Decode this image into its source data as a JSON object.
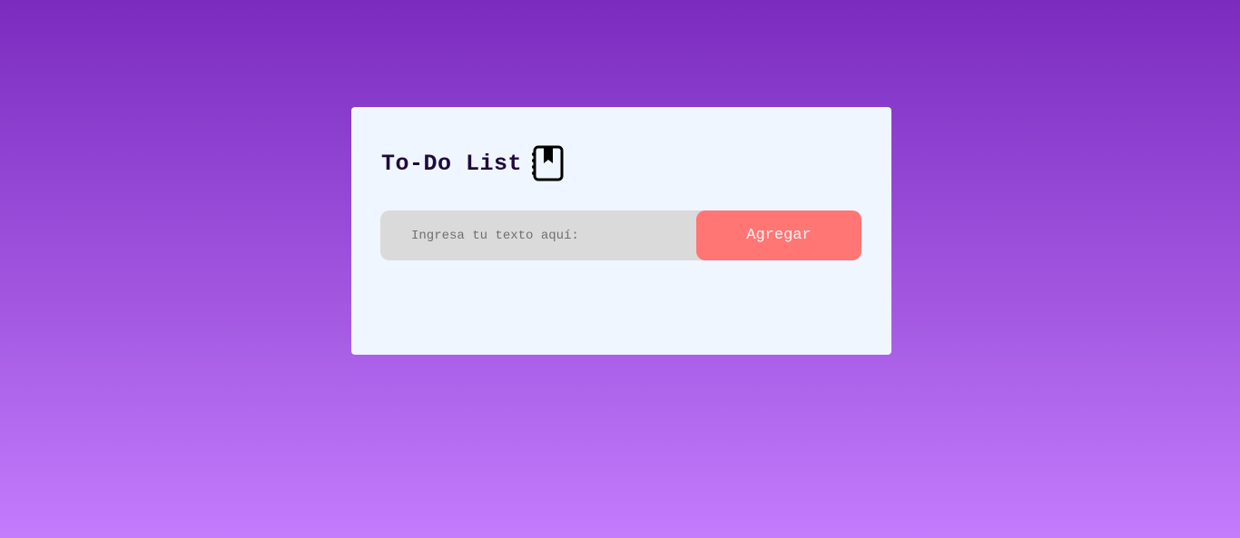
{
  "app": {
    "title": "To-Do List",
    "title_icon": "notebook-bookmark-icon"
  },
  "input": {
    "placeholder": "Ingresa tu texto aquí:",
    "value": ""
  },
  "add_button": {
    "label": "Agregar"
  },
  "colors": {
    "background_top": "#7b2cbf",
    "background_bottom": "#c47cfd",
    "card": "#eff6ff",
    "title": "#1e0b3c",
    "input_bg": "#dadada",
    "button": "#ff7675"
  },
  "tasks": []
}
